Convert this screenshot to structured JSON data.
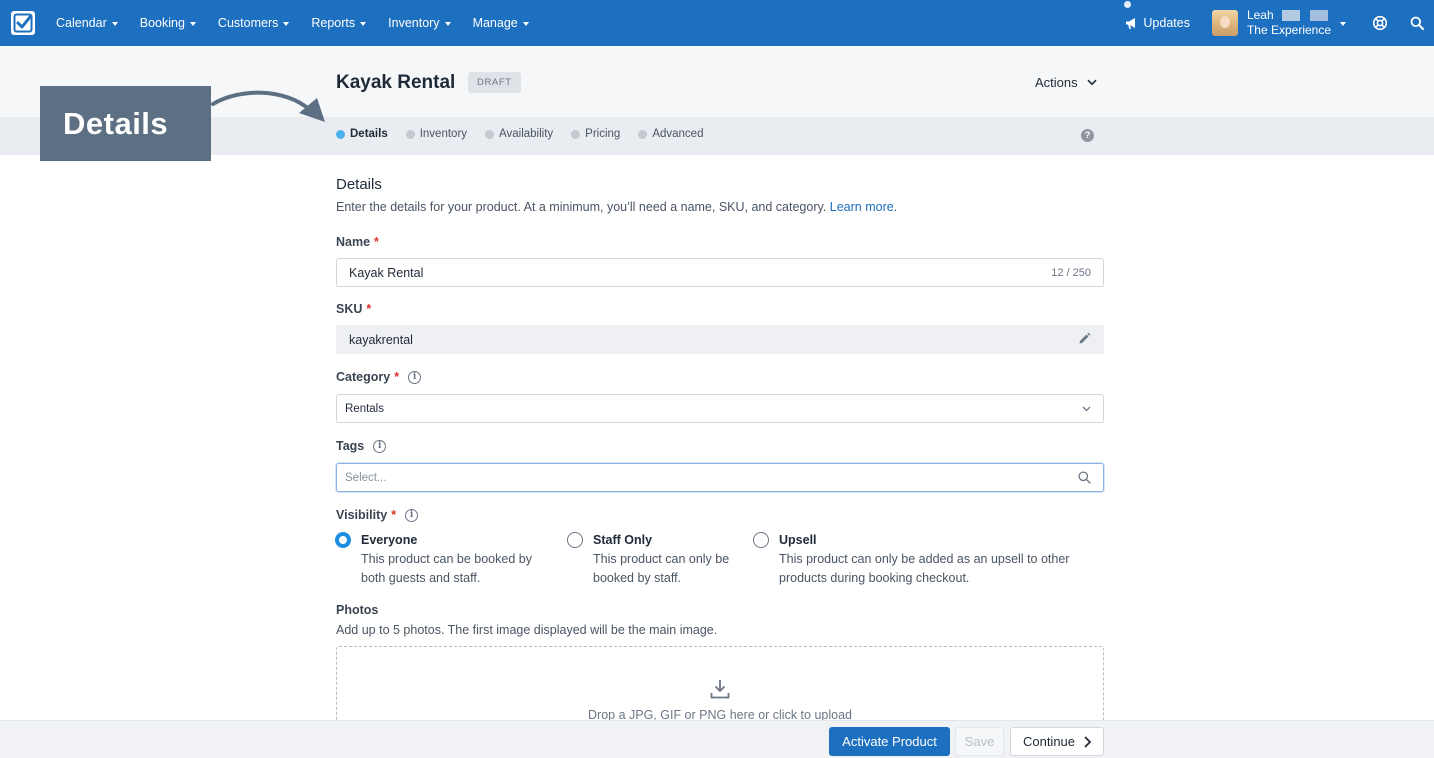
{
  "nav": {
    "items": [
      {
        "label": "Calendar"
      },
      {
        "label": "Booking"
      },
      {
        "label": "Customers"
      },
      {
        "label": "Reports"
      },
      {
        "label": "Inventory"
      },
      {
        "label": "Manage"
      }
    ],
    "updates_label": "Updates",
    "user_name": "Leah",
    "user_org": "The Experience"
  },
  "header": {
    "title": "Kayak Rental",
    "badge": "DRAFT",
    "actions_label": "Actions"
  },
  "tabs": [
    {
      "label": "Details",
      "active": true
    },
    {
      "label": "Inventory",
      "active": false
    },
    {
      "label": "Availability",
      "active": false
    },
    {
      "label": "Pricing",
      "active": false
    },
    {
      "label": "Advanced",
      "active": false
    }
  ],
  "help_glyph": "?",
  "callout": {
    "text": "Details"
  },
  "form": {
    "section_title": "Details",
    "section_desc": "Enter the details for your product. At a minimum, you’ll need a name, SKU, and category.",
    "learn_more": "Learn more",
    "learn_more_suffix": ".",
    "required_mark": "*",
    "name": {
      "label": "Name",
      "value": "Kayak Rental",
      "counter": "12 / 250"
    },
    "sku": {
      "label": "SKU",
      "value": "kayakrental"
    },
    "category": {
      "label": "Category",
      "value": "Rentals"
    },
    "tags": {
      "label": "Tags",
      "placeholder": "Select..."
    },
    "visibility": {
      "label": "Visibility",
      "options": [
        {
          "title": "Everyone",
          "desc_line1": "This product can be booked by",
          "desc_line2": "both guests and staff.",
          "checked": true
        },
        {
          "title": "Staff Only",
          "desc_line1": "This product can only be",
          "desc_line2": "booked by staff.",
          "checked": false
        },
        {
          "title": "Upsell",
          "desc_line1": "This product can only be added as an upsell to other",
          "desc_line2": "products during booking checkout.",
          "checked": false
        }
      ]
    },
    "photos": {
      "label": "Photos",
      "desc": "Add up to 5 photos. The first image displayed will be the main image.",
      "drop_text": "Drop a JPG, GIF or PNG here or click to upload"
    }
  },
  "footer": {
    "activate_label": "Activate Product",
    "save_label": "Save",
    "continue_label": "Continue"
  },
  "colors": {
    "brand": "#1d6fbf",
    "active_tab_dot": "#4db3ec",
    "required": "#d9342b",
    "callout_bg": "#5d6f82"
  }
}
